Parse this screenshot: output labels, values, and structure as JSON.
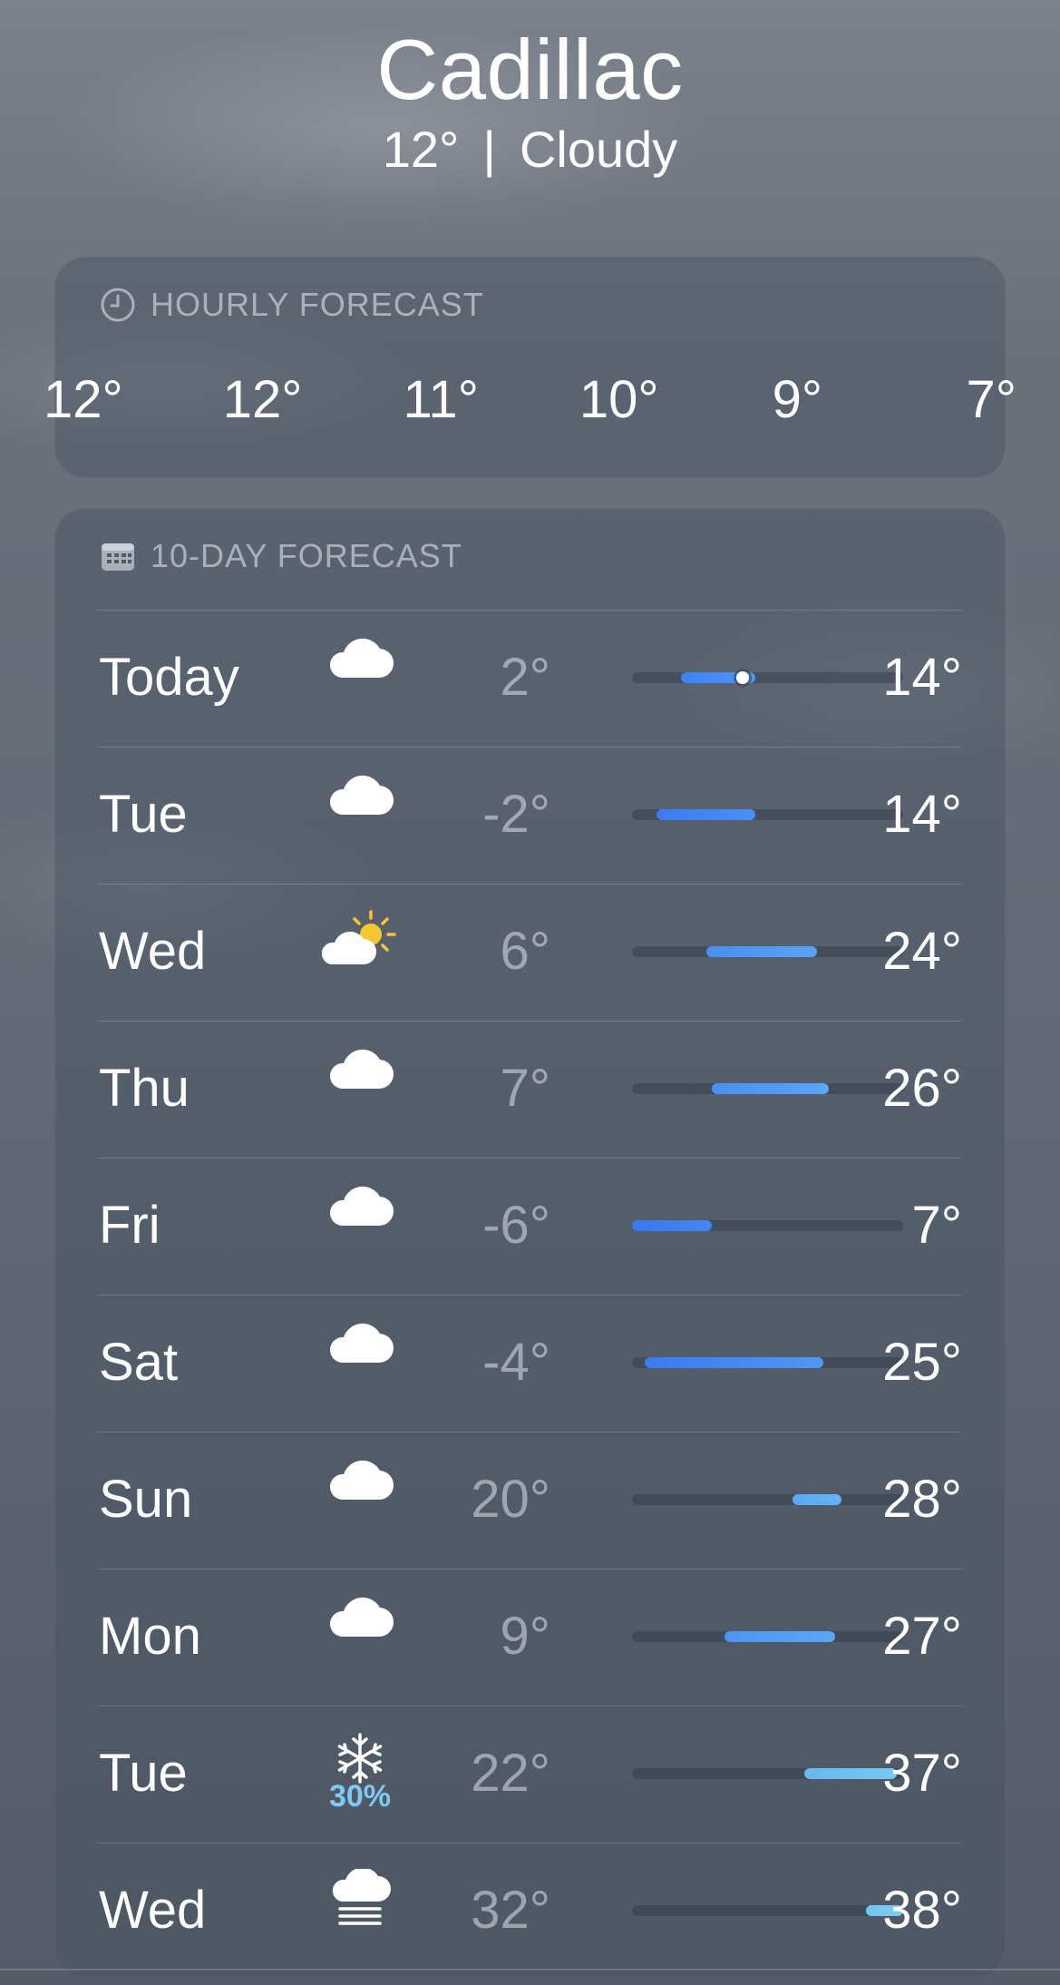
{
  "location": {
    "city": "Cadillac",
    "temp": "12°",
    "separator": "|",
    "condition": "Cloudy"
  },
  "hourly": {
    "title": "HOURLY FORECAST",
    "icon": "clock-icon",
    "temps": [
      "12°",
      "12°",
      "11°",
      "10°",
      "9°",
      "7°"
    ]
  },
  "ten_day": {
    "title": "10-DAY FORECAST",
    "icon": "calendar-icon",
    "range_scale": {
      "min": -6,
      "max": 38
    },
    "current_temp": 12,
    "days": [
      {
        "day": "Today",
        "icon": "cloud-icon",
        "precip": "",
        "low": "2°",
        "high": "14°",
        "low_value": 2,
        "high_value": 14,
        "color_from": "#3b82f6",
        "color_to": "#4f95f5",
        "show_current": true
      },
      {
        "day": "Tue",
        "icon": "cloud-icon",
        "precip": "",
        "low": "-2°",
        "high": "14°",
        "low_value": -2,
        "high_value": 14,
        "color_from": "#3a7cf0",
        "color_to": "#4b8ff5"
      },
      {
        "day": "Wed",
        "icon": "partly-sunny-icon",
        "precip": "",
        "low": "6°",
        "high": "24°",
        "low_value": 6,
        "high_value": 24,
        "color_from": "#4a8ff4",
        "color_to": "#58a3f6"
      },
      {
        "day": "Thu",
        "icon": "cloud-icon",
        "precip": "",
        "low": "7°",
        "high": "26°",
        "low_value": 7,
        "high_value": 26,
        "color_from": "#4a8ff4",
        "color_to": "#5aa6f6"
      },
      {
        "day": "Fri",
        "icon": "cloud-icon",
        "precip": "",
        "low": "-6°",
        "high": "7°",
        "low_value": -6,
        "high_value": 7,
        "color_from": "#3978ef",
        "color_to": "#4386f2"
      },
      {
        "day": "Sat",
        "icon": "cloud-icon",
        "precip": "",
        "low": "-4°",
        "high": "25°",
        "low_value": -4,
        "high_value": 25,
        "color_from": "#3a7bef",
        "color_to": "#4f97f5"
      },
      {
        "day": "Sun",
        "icon": "cloud-icon",
        "precip": "",
        "low": "20°",
        "high": "28°",
        "low_value": 20,
        "high_value": 28,
        "color_from": "#5aa8f6",
        "color_to": "#64b4f6"
      },
      {
        "day": "Mon",
        "icon": "cloud-icon",
        "precip": "",
        "low": "9°",
        "high": "27°",
        "low_value": 9,
        "high_value": 27,
        "color_from": "#4e94f4",
        "color_to": "#5aa6f6"
      },
      {
        "day": "Tue",
        "icon": "snowflake-icon",
        "precip": "30%",
        "low": "22°",
        "high": "37°",
        "low_value": 22,
        "high_value": 37,
        "color_from": "#66b9f0",
        "color_to": "#78c8f2"
      },
      {
        "day": "Wed",
        "icon": "fog-icon",
        "precip": "",
        "low": "32°",
        "high": "38°",
        "low_value": 32,
        "high_value": 38,
        "color_from": "#72c4f0",
        "color_to": "#7ccbf2"
      }
    ]
  }
}
